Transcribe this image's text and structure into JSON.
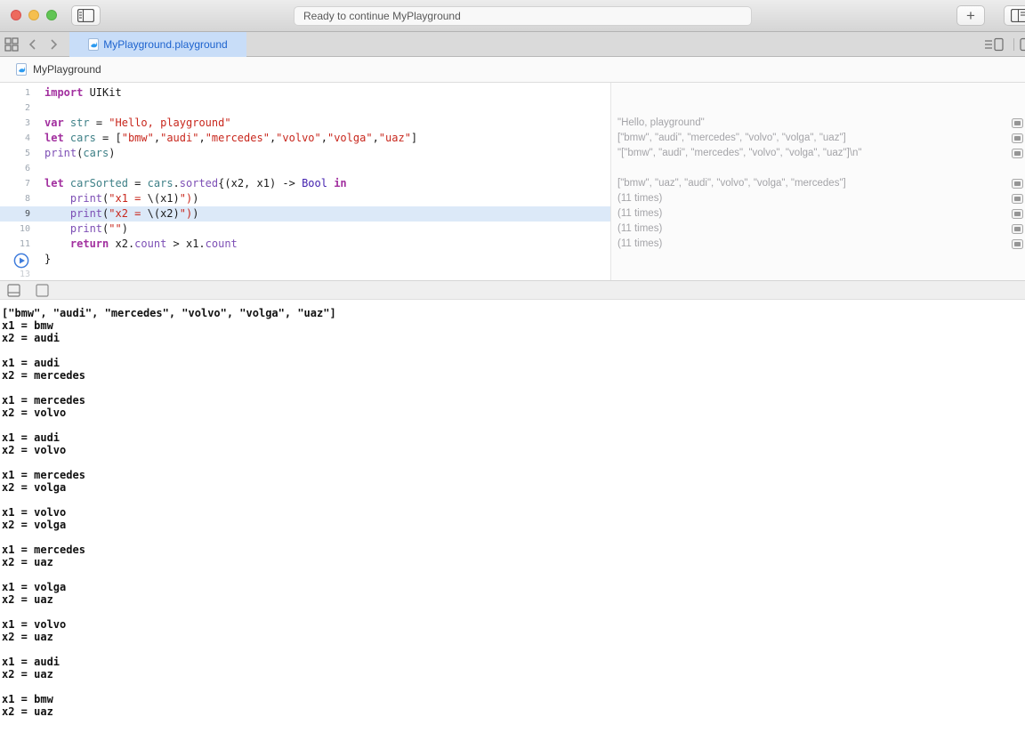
{
  "window": {
    "status_text": "Ready to continue MyPlayground",
    "plus_label": "+"
  },
  "tabbar": {
    "tab_label": "MyPlayground.playground"
  },
  "breadcrumb": {
    "label": "MyPlayground"
  },
  "editor": {
    "lines": [
      {
        "num": "1",
        "tokens": [
          [
            "kw",
            "import"
          ],
          [
            "pl",
            " UIKit"
          ]
        ]
      },
      {
        "num": "2",
        "tokens": []
      },
      {
        "num": "3",
        "tokens": [
          [
            "kw",
            "var"
          ],
          [
            "pl",
            " "
          ],
          [
            "vr",
            "str"
          ],
          [
            "pl",
            " = "
          ],
          [
            "str",
            "\"Hello, playground\""
          ]
        ]
      },
      {
        "num": "4",
        "tokens": [
          [
            "kw",
            "let"
          ],
          [
            "pl",
            " "
          ],
          [
            "vr",
            "cars"
          ],
          [
            "pl",
            " = ["
          ],
          [
            "str",
            "\"bmw\""
          ],
          [
            "pl",
            ","
          ],
          [
            "str",
            "\"audi\""
          ],
          [
            "pl",
            ","
          ],
          [
            "str",
            "\"mercedes\""
          ],
          [
            "pl",
            ","
          ],
          [
            "str",
            "\"volvo\""
          ],
          [
            "pl",
            ","
          ],
          [
            "str",
            "\"volga\""
          ],
          [
            "pl",
            ","
          ],
          [
            "str",
            "\"uaz\""
          ],
          [
            "pl",
            "]"
          ]
        ]
      },
      {
        "num": "5",
        "tokens": [
          [
            "fn",
            "print"
          ],
          [
            "pl",
            "("
          ],
          [
            "vr",
            "cars"
          ],
          [
            "pl",
            ")"
          ]
        ]
      },
      {
        "num": "6",
        "tokens": []
      },
      {
        "num": "7",
        "tokens": [
          [
            "kw",
            "let"
          ],
          [
            "pl",
            " "
          ],
          [
            "vr",
            "carSorted"
          ],
          [
            "pl",
            " = "
          ],
          [
            "vr",
            "cars"
          ],
          [
            "pl",
            "."
          ],
          [
            "fn",
            "sorted"
          ],
          [
            "pl",
            "{(x2, x1) -> "
          ],
          [
            "ty",
            "Bool"
          ],
          [
            "pl",
            " "
          ],
          [
            "kw",
            "in"
          ]
        ]
      },
      {
        "num": "8",
        "tokens": [
          [
            "pl",
            "    "
          ],
          [
            "fn",
            "print"
          ],
          [
            "pl",
            "("
          ],
          [
            "str",
            "\"x1 = "
          ],
          [
            "pl",
            "\\(x1)"
          ],
          [
            "str",
            "\")"
          ],
          [
            "pl",
            ")"
          ]
        ]
      },
      {
        "num": "9",
        "highlight": true,
        "current": true,
        "tokens": [
          [
            "pl",
            "    "
          ],
          [
            "fn",
            "print"
          ],
          [
            "pl",
            "("
          ],
          [
            "str",
            "\"x2 = "
          ],
          [
            "pl",
            "\\(x2)"
          ],
          [
            "str",
            "\")"
          ],
          [
            "pl",
            ")"
          ]
        ]
      },
      {
        "num": "10",
        "tokens": [
          [
            "pl",
            "    "
          ],
          [
            "fn",
            "print"
          ],
          [
            "pl",
            "("
          ],
          [
            "str",
            "\"\""
          ],
          [
            "pl",
            ")"
          ]
        ]
      },
      {
        "num": "11",
        "tokens": [
          [
            "pl",
            "    "
          ],
          [
            "kw",
            "return"
          ],
          [
            "pl",
            " x2."
          ],
          [
            "fn",
            "count"
          ],
          [
            "pl",
            " > x1."
          ],
          [
            "fn",
            "count"
          ]
        ]
      },
      {
        "num": "",
        "play": true,
        "tokens": [
          [
            "pl",
            "}"
          ]
        ]
      },
      {
        "num": "13",
        "dim": true,
        "tokens": []
      }
    ]
  },
  "results": {
    "rows": [
      {
        "line": 3,
        "text": "\"Hello, playground\""
      },
      {
        "line": 4,
        "text": "[\"bmw\", \"audi\", \"mercedes\", \"volvo\", \"volga\", \"uaz\"]"
      },
      {
        "line": 5,
        "text": "\"[\"bmw\", \"audi\", \"mercedes\", \"volvo\", \"volga\", \"uaz\"]\\n\""
      },
      {
        "line": 7,
        "text": "[\"bmw\", \"uaz\", \"audi\", \"volvo\", \"volga\", \"mercedes\"]"
      },
      {
        "line": 8,
        "text": "(11 times)"
      },
      {
        "line": 9,
        "text": "(11 times)"
      },
      {
        "line": 10,
        "text": "(11 times)"
      },
      {
        "line": 11,
        "text": "(11 times)"
      }
    ]
  },
  "console": {
    "lines": [
      "[\"bmw\", \"audi\", \"mercedes\", \"volvo\", \"volga\", \"uaz\"]",
      "x1 = bmw",
      "x2 = audi",
      "",
      "x1 = audi",
      "x2 = mercedes",
      "",
      "x1 = mercedes",
      "x2 = volvo",
      "",
      "x1 = audi",
      "x2 = volvo",
      "",
      "x1 = mercedes",
      "x2 = volga",
      "",
      "x1 = volvo",
      "x2 = volga",
      "",
      "x1 = mercedes",
      "x2 = uaz",
      "",
      "x1 = volga",
      "x2 = uaz",
      "",
      "x1 = volvo",
      "x2 = uaz",
      "",
      "x1 = audi",
      "x2 = uaz",
      "",
      "x1 = bmw",
      "x2 = uaz"
    ]
  },
  "colors": {
    "accent_blue": "#1D63CE",
    "tab_active_bg": "#C8DDF8",
    "current_line_bg": "#DCE9F8",
    "keyword": "#A2309F",
    "string": "#C8271D",
    "function": "#7D4FB5",
    "variable": "#3E8087",
    "type": "#4422AF",
    "result_text": "#A4A4A8"
  }
}
